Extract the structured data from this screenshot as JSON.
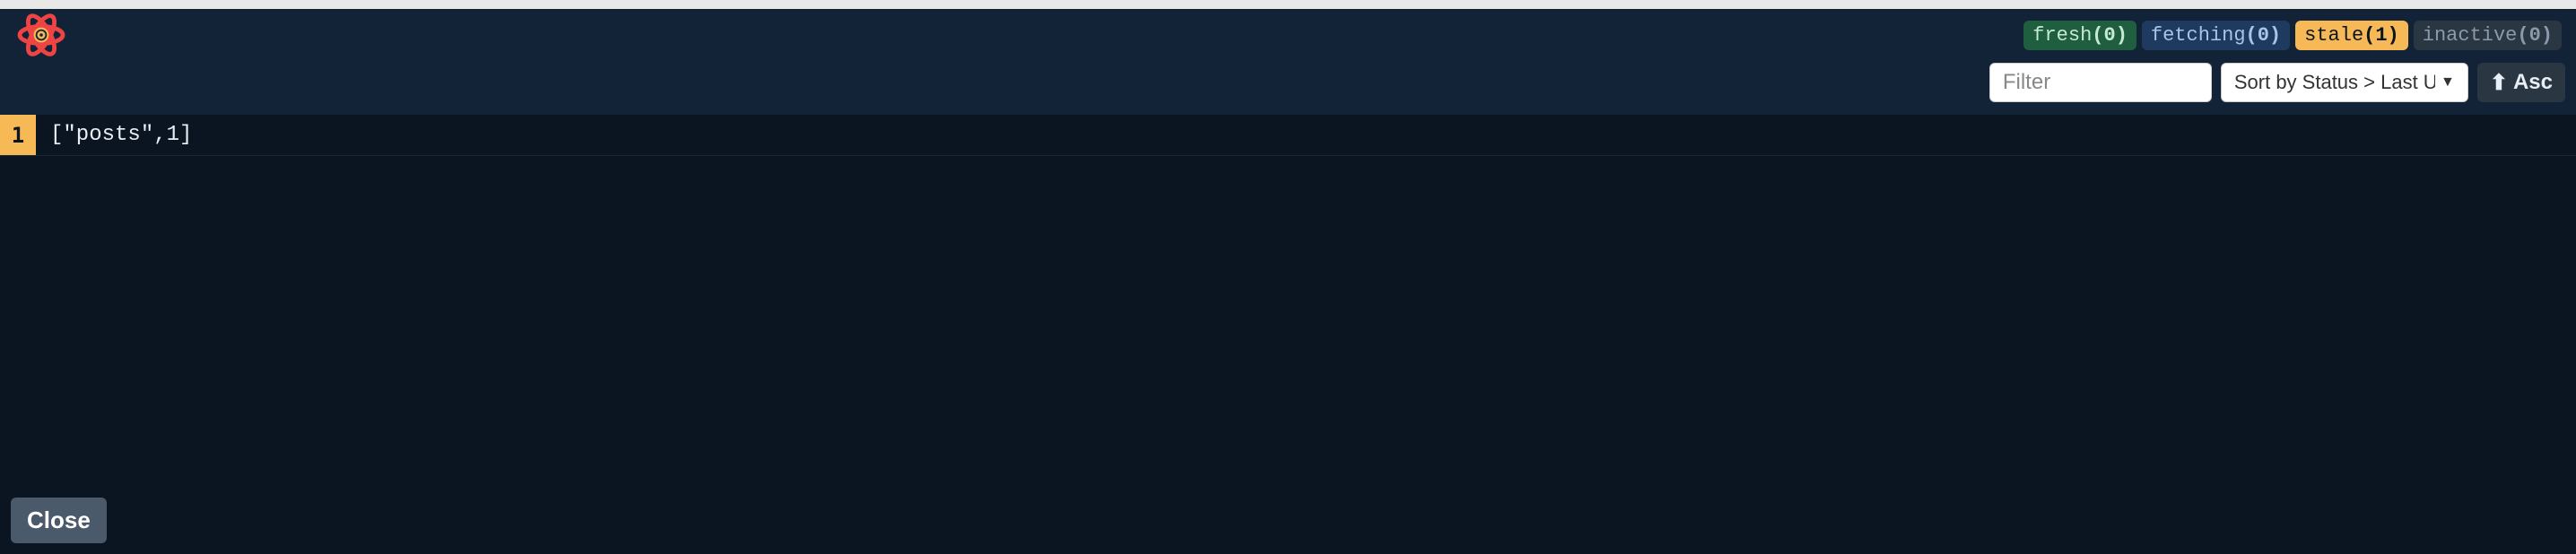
{
  "badges": {
    "fresh": {
      "label": "fresh",
      "count": "(0)"
    },
    "fetching": {
      "label": "fetching",
      "count": "(0)"
    },
    "stale": {
      "label": "stale",
      "count": "(1)"
    },
    "inactive": {
      "label": "inactive",
      "count": "(0)"
    }
  },
  "filter": {
    "placeholder": "Filter",
    "value": ""
  },
  "sort": {
    "label": "Sort by Status > Last Updat"
  },
  "direction": {
    "label": "Asc"
  },
  "queries": [
    {
      "observers": "1",
      "key": "[\"posts\",1]"
    }
  ],
  "close": {
    "label": "Close"
  }
}
